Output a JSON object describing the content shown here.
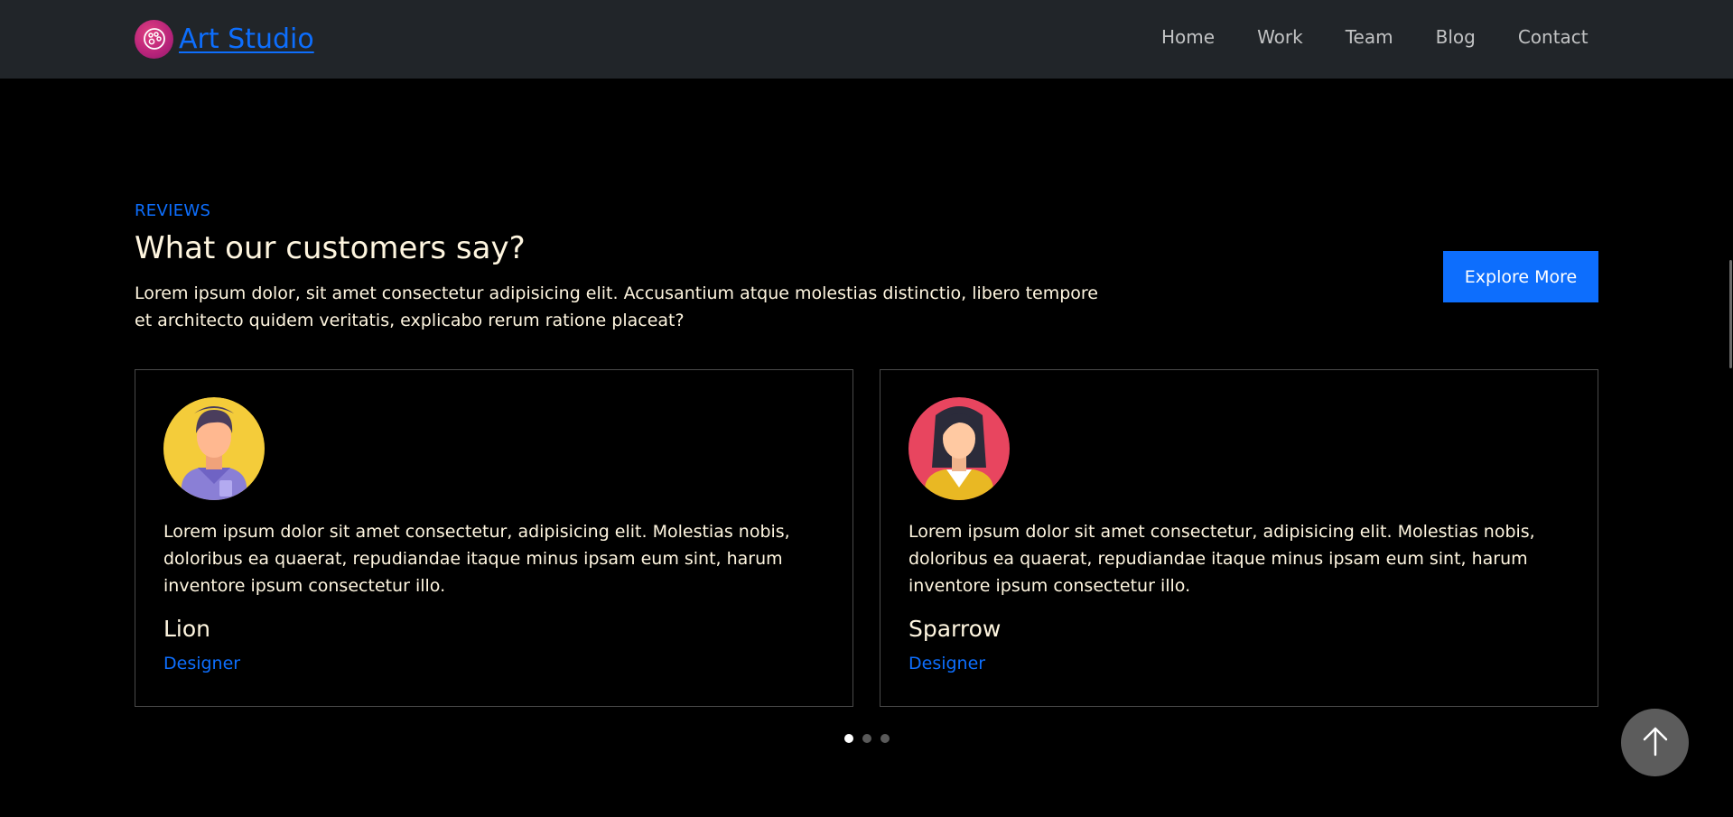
{
  "navbar": {
    "brand": "Art Studio",
    "links": [
      "Home",
      "Work",
      "Team",
      "Blog",
      "Contact"
    ]
  },
  "section": {
    "eyebrow": "REVIEWS",
    "title": "What our customers say?",
    "lead": "Lorem ipsum dolor, sit amet consectetur adipisicing elit. Accusantium atque molestias distinctio, libero tempore et architecto quidem veritatis, explicabo rerum ratione placeat?",
    "explore_label": "Explore More"
  },
  "reviews": [
    {
      "quote": "Lorem ipsum dolor sit amet consectetur, adipisicing elit. Molestias nobis, doloribus ea quaerat, repudiandae itaque minus ipsam eum sint, harum inventore ipsum consectetur illo.",
      "name": "Lion",
      "role": "Designer",
      "avatar_icon": "male-avatar-icon"
    },
    {
      "quote": "Lorem ipsum dolor sit amet consectetur, adipisicing elit. Molestias nobis, doloribus ea quaerat, repudiandae itaque minus ipsam eum sint, harum inventore ipsum consectetur illo.",
      "name": "Sparrow",
      "role": "Designer",
      "avatar_icon": "female-avatar-icon"
    }
  ],
  "pagination": {
    "total": 3,
    "active": 0
  },
  "colors": {
    "accent": "#0d6efd",
    "navbar_bg": "#212529",
    "page_bg": "#000000",
    "text": "#fff6e0"
  }
}
